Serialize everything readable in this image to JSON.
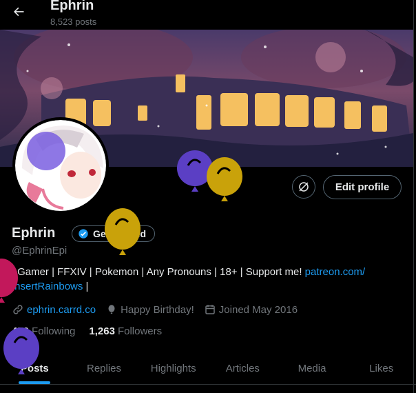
{
  "header": {
    "title": "Ephrin",
    "post_count": "8,523 posts",
    "back_icon": "arrow-left-icon"
  },
  "profile": {
    "display_name": "Ephrin",
    "handle": "@EphrinEpi",
    "verify_label": "Get verified",
    "edit_label": "Edit profile",
    "bio_text": "| Gamer | FFXIV | Pokemon | Any Pronouns | 18+ | Support me! ",
    "bio_link_1": "patreon.com/",
    "bio_link_2": "InsertRainbows",
    "bio_tail": " |",
    "website": "ephrin.carrd.co",
    "birthday": "Happy Birthday!",
    "joined": "Joined May 2016",
    "following_count": "459",
    "following_label": "Following",
    "followers_count": "1,263",
    "followers_label": "Followers"
  },
  "tabs": [
    {
      "label": "Posts",
      "active": true
    },
    {
      "label": "Replies",
      "active": false
    },
    {
      "label": "Highlights",
      "active": false
    },
    {
      "label": "Articles",
      "active": false
    },
    {
      "label": "Media",
      "active": false
    },
    {
      "label": "Likes",
      "active": false
    }
  ],
  "colors": {
    "accent": "#1d9bf0",
    "background": "#000000",
    "muted": "#71767b",
    "balloon_purple": "#5b3fc4",
    "balloon_gold": "#c9a20a",
    "balloon_pink": "#c2185b"
  }
}
